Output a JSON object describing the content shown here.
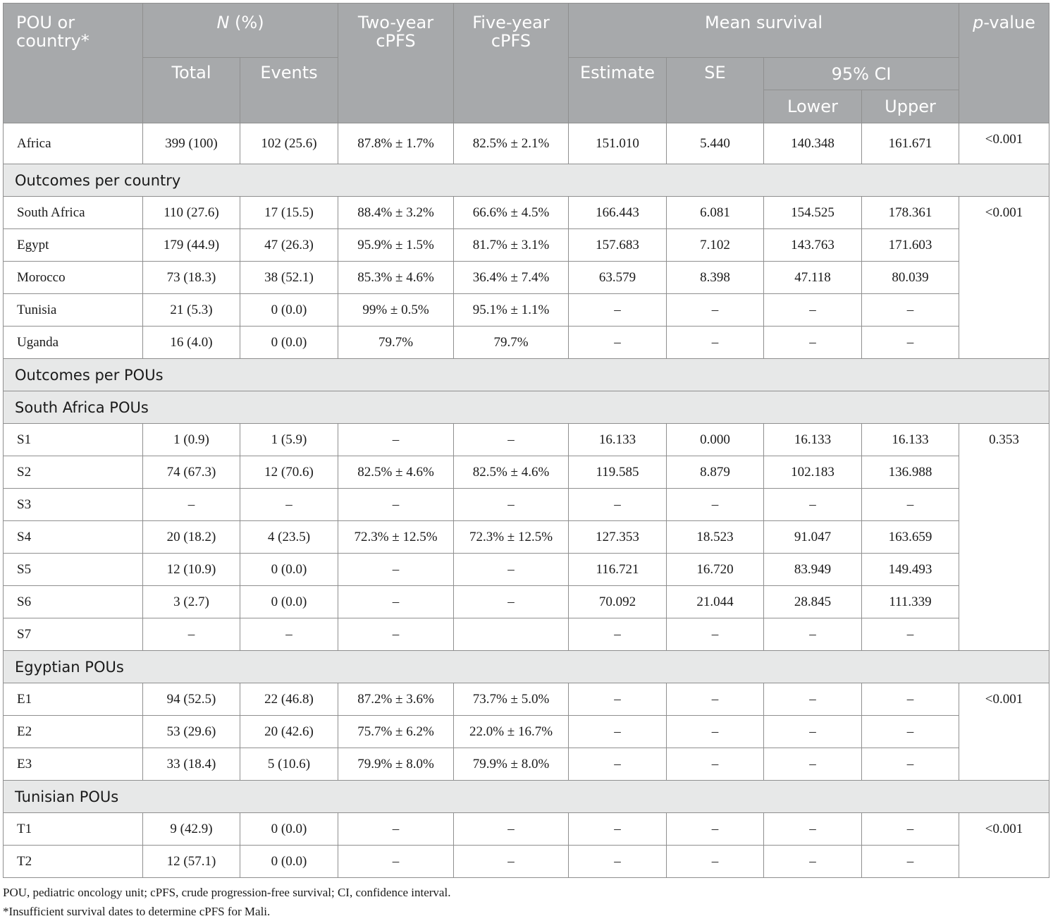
{
  "header": {
    "col1": "POU or country*",
    "n_pct": "N (%)",
    "n_pct_italic": "N",
    "n_pct_rest": " (%)",
    "total": "Total",
    "events": "Events",
    "two_year": "Two-year cPFS",
    "five_year": "Five-year cPFS",
    "mean_survival": "Mean survival",
    "estimate": "Estimate",
    "se": "SE",
    "ci": "95% CI",
    "lower": "Lower",
    "upper": "Upper",
    "pvalue": "p-value",
    "pvalue_italic": "p",
    "pvalue_rest": "-value"
  },
  "africa": {
    "label": "Africa",
    "total": "399 (100)",
    "events": "102 (25.6)",
    "two_year": "87.8% ± 1.7%",
    "five_year": "82.5% ± 2.1%",
    "estimate": "151.010",
    "se": "5.440",
    "lower": "140.348",
    "upper": "161.671",
    "pvalue": "<0.001"
  },
  "sections": {
    "per_country": "Outcomes per country",
    "per_pou": "Outcomes per POUs",
    "south_africa": "South Africa POUs",
    "egypt": "Egyptian POUs",
    "tunisia": "Tunisian POUs"
  },
  "countries": {
    "pvalue": "<0.001",
    "rows": [
      {
        "label": "South Africa",
        "total": "110 (27.6)",
        "events": "17 (15.5)",
        "two_year": "88.4% ± 3.2%",
        "five_year": "66.6% ± 4.5%",
        "estimate": "166.443",
        "se": "6.081",
        "lower": "154.525",
        "upper": "178.361"
      },
      {
        "label": "Egypt",
        "total": "179 (44.9)",
        "events": "47 (26.3)",
        "two_year": "95.9% ± 1.5%",
        "five_year": "81.7% ± 3.1%",
        "estimate": "157.683",
        "se": "7.102",
        "lower": "143.763",
        "upper": "171.603"
      },
      {
        "label": "Morocco",
        "total": "73 (18.3)",
        "events": "38 (52.1)",
        "two_year": "85.3% ± 4.6%",
        "five_year": "36.4% ± 7.4%",
        "estimate": "63.579",
        "se": "8.398",
        "lower": "47.118",
        "upper": "80.039"
      },
      {
        "label": "Tunisia",
        "total": "21 (5.3)",
        "events": "0 (0.0)",
        "two_year": "99% ± 0.5%",
        "five_year": "95.1% ± 1.1%",
        "estimate": "–",
        "se": "–",
        "lower": "–",
        "upper": "–"
      },
      {
        "label": "Uganda",
        "total": "16 (4.0)",
        "events": "0 (0.0)",
        "two_year": "79.7%",
        "five_year": "79.7%",
        "estimate": "–",
        "se": "–",
        "lower": "–",
        "upper": "–"
      }
    ]
  },
  "sa_pous": {
    "pvalue": "0.353",
    "rows": [
      {
        "label": "S1",
        "total": "1 (0.9)",
        "events": "1 (5.9)",
        "two_year": "–",
        "five_year": "–",
        "estimate": "16.133",
        "se": "0.000",
        "lower": "16.133",
        "upper": "16.133"
      },
      {
        "label": "S2",
        "total": "74 (67.3)",
        "events": "12 (70.6)",
        "two_year": "82.5% ± 4.6%",
        "five_year": "82.5% ± 4.6%",
        "estimate": "119.585",
        "se": "8.879",
        "lower": "102.183",
        "upper": "136.988"
      },
      {
        "label": "S3",
        "total": "–",
        "events": "–",
        "two_year": "–",
        "five_year": "–",
        "estimate": "–",
        "se": "–",
        "lower": "–",
        "upper": "–"
      },
      {
        "label": "S4",
        "total": "20 (18.2)",
        "events": "4 (23.5)",
        "two_year": "72.3% ± 12.5%",
        "five_year": "72.3% ± 12.5%",
        "estimate": "127.353",
        "se": "18.523",
        "lower": "91.047",
        "upper": "163.659"
      },
      {
        "label": "S5",
        "total": "12 (10.9)",
        "events": "0 (0.0)",
        "two_year": "–",
        "five_year": "–",
        "estimate": "116.721",
        "se": "16.720",
        "lower": "83.949",
        "upper": "149.493"
      },
      {
        "label": "S6",
        "total": "3 (2.7)",
        "events": "0 (0.0)",
        "two_year": "–",
        "five_year": "–",
        "estimate": "70.092",
        "se": "21.044",
        "lower": "28.845",
        "upper": "111.339"
      },
      {
        "label": "S7",
        "total": "–",
        "events": "–",
        "two_year": "–",
        "five_year": "",
        "estimate": "–",
        "se": "–",
        "lower": "–",
        "upper": "–"
      }
    ]
  },
  "eg_pous": {
    "pvalue": "<0.001",
    "rows": [
      {
        "label": "E1",
        "total": "94 (52.5)",
        "events": "22 (46.8)",
        "two_year": "87.2% ± 3.6%",
        "five_year": "73.7% ± 5.0%",
        "estimate": "–",
        "se": "–",
        "lower": "–",
        "upper": "–"
      },
      {
        "label": "E2",
        "total": "53 (29.6)",
        "events": "20 (42.6)",
        "two_year": "75.7% ± 6.2%",
        "five_year": "22.0% ± 16.7%",
        "estimate": "–",
        "se": "–",
        "lower": "–",
        "upper": "–"
      },
      {
        "label": "E3",
        "total": "33 (18.4)",
        "events": "5 (10.6)",
        "two_year": "79.9% ± 8.0%",
        "five_year": "79.9% ± 8.0%",
        "estimate": "–",
        "se": "–",
        "lower": "–",
        "upper": "–"
      }
    ]
  },
  "tn_pous": {
    "pvalue": "<0.001",
    "rows": [
      {
        "label": "T1",
        "total": "9 (42.9)",
        "events": "0 (0.0)",
        "two_year": "–",
        "five_year": "–",
        "estimate": "–",
        "se": "–",
        "lower": "–",
        "upper": "–"
      },
      {
        "label": "T2",
        "total": "12 (57.1)",
        "events": "0 (0.0)",
        "two_year": "–",
        "five_year": "–",
        "estimate": "–",
        "se": "–",
        "lower": "–",
        "upper": "–"
      }
    ]
  },
  "footnotes": {
    "abbrev": "POU, pediatric oncology unit; cPFS, crude progression-free survival; CI, confidence interval.",
    "mali": "*Insufficient survival dates to determine cPFS for Mali."
  }
}
